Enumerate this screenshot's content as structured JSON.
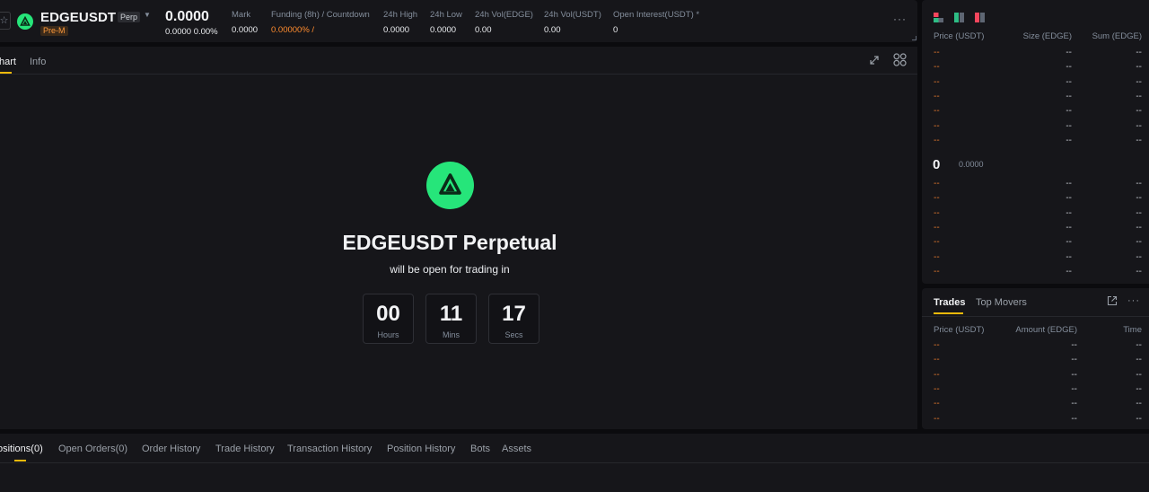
{
  "header": {
    "symbol": "EDGEUSDT",
    "perp_badge": "Perp",
    "market_badge": "Pre-M",
    "last_price": "0.0000",
    "change": "0.0000 0.00%",
    "stats": [
      {
        "label": "Mark",
        "value": "0.0000"
      },
      {
        "label": "Funding (8h) / Countdown",
        "value": "0.00000% /"
      },
      {
        "label": "24h High",
        "value": "0.0000"
      },
      {
        "label": "24h Low",
        "value": "0.0000"
      },
      {
        "label": "24h Vol(EDGE)",
        "value": "0.00"
      },
      {
        "label": "24h Vol(USDT)",
        "value": "0.00"
      },
      {
        "label": "Open Interest(USDT) *",
        "value": "0"
      }
    ],
    "more": "···"
  },
  "chart_panel": {
    "tabs": [
      "hart",
      "Info"
    ],
    "active_tab": "hart",
    "launch_title": "EDGEUSDT Perpetual",
    "launch_subtitle": "will be open for trading in",
    "countdown": [
      {
        "value": "00",
        "unit": "Hours"
      },
      {
        "value": "11",
        "unit": "Mins"
      },
      {
        "value": "17",
        "unit": "Secs"
      }
    ]
  },
  "orderbook": {
    "headers": {
      "price": "Price (USDT)",
      "size": "Size (EDGE)",
      "sum": "Sum (EDGE)"
    },
    "asks": [
      [
        "--",
        "--",
        "--"
      ],
      [
        "--",
        "--",
        "--"
      ],
      [
        "--",
        "--",
        "--"
      ],
      [
        "--",
        "--",
        "--"
      ],
      [
        "--",
        "--",
        "--"
      ],
      [
        "--",
        "--",
        "--"
      ],
      [
        "--",
        "--",
        "--"
      ]
    ],
    "mid_price": "0",
    "mid_mark": "0.0000",
    "bids": [
      [
        "--",
        "--",
        "--"
      ],
      [
        "--",
        "--",
        "--"
      ],
      [
        "--",
        "--",
        "--"
      ],
      [
        "--",
        "--",
        "--"
      ],
      [
        "--",
        "--",
        "--"
      ],
      [
        "--",
        "--",
        "--"
      ],
      [
        "--",
        "--",
        "--"
      ]
    ],
    "colors": {
      "ask": "#e87b2d",
      "bid_dot": "#2ebd85",
      "sell_dot": "#f6465d"
    }
  },
  "trades": {
    "tabs": [
      "Trades",
      "Top Movers"
    ],
    "headers": {
      "price": "Price (USDT)",
      "amount": "Amount (EDGE)",
      "time": "Time"
    },
    "rows": [
      [
        "--",
        "--",
        "--"
      ],
      [
        "--",
        "--",
        "--"
      ],
      [
        "--",
        "--",
        "--"
      ],
      [
        "--",
        "--",
        "--"
      ],
      [
        "--",
        "--",
        "--"
      ],
      [
        "--",
        "--",
        "--"
      ]
    ],
    "more": "···"
  },
  "bottom": {
    "tabs": [
      "ositions(0)",
      "Open Orders(0)",
      "Order History",
      "Trade History",
      "Transaction History",
      "Position History",
      "Bots",
      "Assets"
    ]
  },
  "colors": {
    "accent": "#f0b90b",
    "brand_green": "#26e57a",
    "panel": "#16161a",
    "background": "#0b0b0e"
  }
}
